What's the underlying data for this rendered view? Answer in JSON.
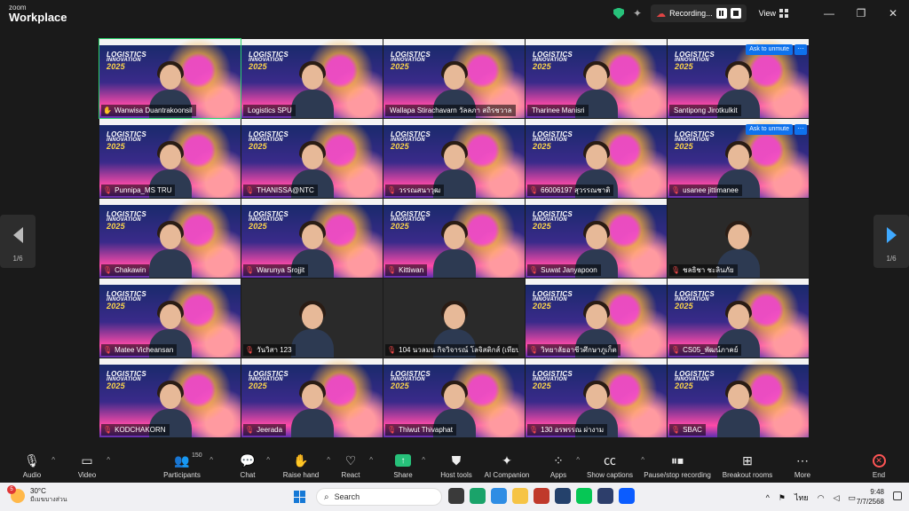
{
  "app": {
    "brand_top": "zoom",
    "brand_name": "Workplace"
  },
  "topbar": {
    "recording_label": "Recording...",
    "view_label": "View"
  },
  "pager": {
    "left": "1/6",
    "right": "1/6"
  },
  "tiles": [
    {
      "name": "Wanwisa Duantrakoonsil",
      "muted": false
    },
    {
      "name": "Logistics SPU",
      "muted": false
    },
    {
      "name": "Wallapa Stirachavarn วัลลภา สถิรชวาล",
      "muted": false
    },
    {
      "name": "Tharinee Manisri",
      "muted": false
    },
    {
      "name": "Santipong Jirotkulkit",
      "muted": false,
      "ask": "Ask to unmute"
    },
    {
      "name": "Punnipa_MS TRU",
      "muted": true
    },
    {
      "name": "THANISSA@NTC",
      "muted": true
    },
    {
      "name": "วรรณสนาวุฒ",
      "muted": true
    },
    {
      "name": "66006197 สุวรรณชาติ",
      "muted": true
    },
    {
      "name": "usanee jittimanee",
      "muted": true,
      "ask": "Ask to unmute"
    },
    {
      "name": "Chakawin",
      "muted": true
    },
    {
      "name": "Warunya Srojjit",
      "muted": true
    },
    {
      "name": "Kittiwan",
      "muted": true
    },
    {
      "name": "Suwat Janyapoon",
      "muted": true
    },
    {
      "name": "ชลธิชา ชะลินภัย",
      "muted": true
    },
    {
      "name": "Matee Vicheansan",
      "muted": true
    },
    {
      "name": "วันวิสา 123",
      "muted": true
    },
    {
      "name": "104 นวลมน กิจวิจารณ์ โลจิสติกส์ (เทียบโอ...",
      "muted": true
    },
    {
      "name": "วิทยาลัยอาชีวศึกษาภูเก็ต",
      "muted": true
    },
    {
      "name": "CS05_พัฒน์ภาคย์",
      "muted": true
    },
    {
      "name": "KODCHAKORN",
      "muted": true
    },
    {
      "name": "Jeerada",
      "muted": true
    },
    {
      "name": "Thiwut Thivaphat",
      "muted": true
    },
    {
      "name": "130 อรพรรณ ผ่างาม",
      "muted": true
    },
    {
      "name": "SBAC",
      "muted": true
    }
  ],
  "banner": {
    "line1": "LOGISTICS",
    "line2": "INNOVATION",
    "year": "2025"
  },
  "toolbar": {
    "audio": "Audio",
    "video": "Video",
    "participants": "Participants",
    "participants_count": "150",
    "chat": "Chat",
    "raise_hand": "Raise hand",
    "react": "React",
    "share": "Share",
    "host_tools": "Host tools",
    "ai_companion": "AI Companion",
    "apps": "Apps",
    "show_captions": "Show captions",
    "pause_stop_recording": "Pause/stop recording",
    "breakout_rooms": "Breakout rooms",
    "more": "More",
    "end": "End"
  },
  "taskbar": {
    "weather_temp": "30°C",
    "weather_desc": "มีเมฆบางส่วน",
    "weather_badge": "5",
    "search_placeholder": "Search",
    "lang": "ไทย",
    "time": "9:48",
    "date": "7/7/2568"
  },
  "colors": {
    "active_border": "#2ad16b",
    "muted_mic": "#ff4d4d",
    "ask_unmute": "#0e72ed",
    "share_green": "#27c17a"
  }
}
